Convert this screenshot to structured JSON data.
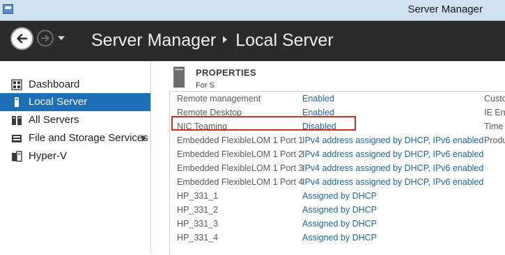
{
  "window": {
    "title": "Server Manager"
  },
  "header": {
    "breadcrumb": [
      "Server Manager",
      "Local Server"
    ]
  },
  "sidebar": {
    "items": [
      {
        "label": "Dashboard",
        "icon": "dashboard-icon",
        "selected": false
      },
      {
        "label": "Local Server",
        "icon": "server-icon",
        "selected": true
      },
      {
        "label": "All Servers",
        "icon": "servers-icon",
        "selected": false
      },
      {
        "label": "File and Storage Services",
        "icon": "storage-icon",
        "selected": false,
        "expandable": true
      },
      {
        "label": "Hyper-V",
        "icon": "hyperv-icon",
        "selected": false
      }
    ]
  },
  "properties": {
    "title": "PROPERTIES",
    "subtitle": "For S"
  },
  "rows": [
    {
      "key": "Remote management",
      "value": "Enabled",
      "right": "Custo"
    },
    {
      "key": "Remote Desktop",
      "value": "Enabled",
      "right": "IE Enh"
    },
    {
      "key": "NIC Teaming",
      "value": "Disabled",
      "right": "Time z"
    },
    {
      "key": "Embedded FlexibleLOM 1 Port 1",
      "value": "IPv4 address assigned by DHCP, IPv6 enabled",
      "right": "Produ"
    },
    {
      "key": "Embedded FlexibleLOM 1 Port 2",
      "value": "IPv4 address assigned by DHCP, IPv6 enabled",
      "right": ""
    },
    {
      "key": "Embedded FlexibleLOM 1 Port 3",
      "value": "IPv4 address assigned by DHCP, IPv6 enabled",
      "right": ""
    },
    {
      "key": "Embedded FlexibleLOM 1 Port 4",
      "value": "IPv4 address assigned by DHCP, IPv6 enabled",
      "right": ""
    },
    {
      "key": "HP_331_1",
      "value": "Assigned by DHCP",
      "right": ""
    },
    {
      "key": "HP_331_2",
      "value": "Assigned by DHCP",
      "right": ""
    },
    {
      "key": "HP_331_3",
      "value": "Assigned by DHCP",
      "right": ""
    },
    {
      "key": "HP_331_4",
      "value": "Assigned by DHCP",
      "right": ""
    }
  ],
  "colors": {
    "accent": "#1c6fb5",
    "link": "#1a64b3",
    "highlight": "#d42a2a",
    "header_bg": "#2b2b2b"
  }
}
